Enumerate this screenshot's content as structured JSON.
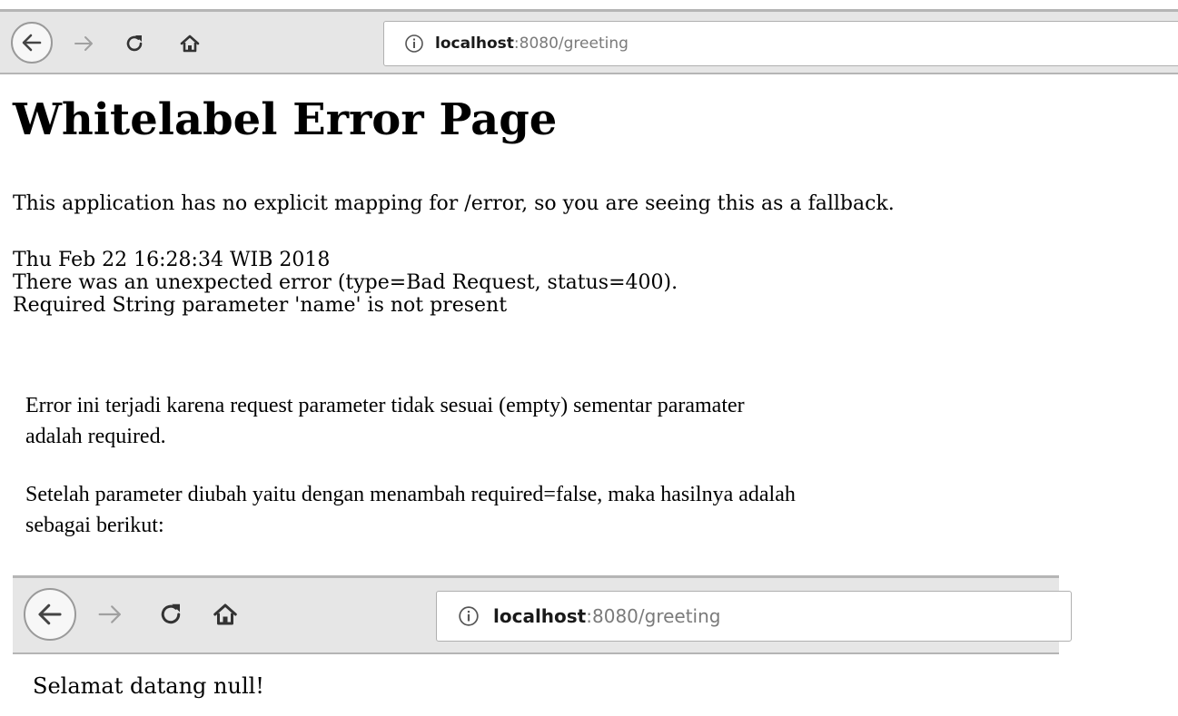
{
  "browser_top": {
    "url_host": "localhost",
    "url_path": ":8080/greeting",
    "icons": {
      "back": "back-arrow-icon",
      "forward": "forward-arrow-icon",
      "reload": "reload-icon",
      "home": "home-icon",
      "info": "info-icon"
    }
  },
  "error_page": {
    "title": "Whitelabel Error Page",
    "message": "This application has no explicit mapping for /error, so you are seeing this as a fallback.",
    "timestamp": "Thu Feb 22 16:28:34 WIB 2018",
    "error_line": "There was an unexpected error (type=Bad Request, status=400).",
    "detail_line": "Required String parameter 'name' is not present"
  },
  "explanation": {
    "paragraph_1_line_1": "Error ini terjadi karena request parameter tidak sesuai (empty) sementar paramater",
    "paragraph_1_line_2": "adalah required.",
    "paragraph_2_line_1": "Setelah parameter diubah yaitu dengan menambah required=false, maka hasilnya adalah",
    "paragraph_2_line_2": "sebagai berikut:"
  },
  "browser_bottom": {
    "url_host": "localhost",
    "url_path": ":8080/greeting"
  },
  "result": {
    "greeting_text": "Selamat datang null!"
  }
}
